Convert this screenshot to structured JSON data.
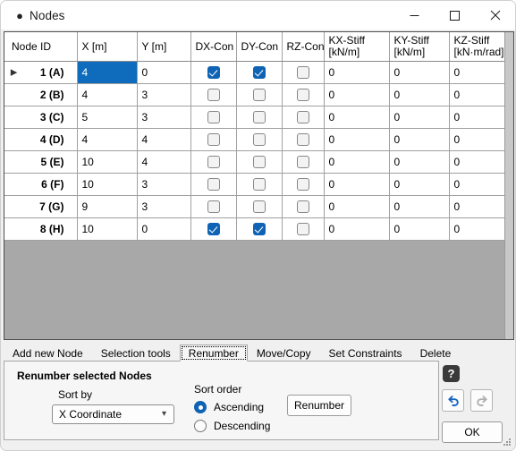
{
  "window": {
    "title": "Nodes",
    "icon": "app-dot-icon",
    "minimize": "—",
    "maximize": "☐",
    "close": "✕"
  },
  "table": {
    "columns": [
      {
        "line1": "Node ID",
        "line2": ""
      },
      {
        "line1": "X [m]",
        "line2": ""
      },
      {
        "line1": "Y [m]",
        "line2": ""
      },
      {
        "line1": "DX-Con",
        "line2": ""
      },
      {
        "line1": "DY-Con",
        "line2": ""
      },
      {
        "line1": "RZ-Con",
        "line2": ""
      },
      {
        "line1": "KX-Stiff",
        "line2": "[kN/m]"
      },
      {
        "line1": "KY-Stiff",
        "line2": "[kN/m]"
      },
      {
        "line1": "KZ-Stiff",
        "line2": "[kN·m/rad]"
      }
    ],
    "rows": [
      {
        "node": "1 (A)",
        "x": "4",
        "y": "0",
        "dx": true,
        "dy": true,
        "rz": false,
        "kx": "0",
        "ky": "0",
        "kz": "0",
        "marker": "▶",
        "selected_cell": "x"
      },
      {
        "node": "2 (B)",
        "x": "4",
        "y": "3",
        "dx": false,
        "dy": false,
        "rz": false,
        "kx": "0",
        "ky": "0",
        "kz": "0",
        "marker": "",
        "selected_cell": ""
      },
      {
        "node": "3 (C)",
        "x": "5",
        "y": "3",
        "dx": false,
        "dy": false,
        "rz": false,
        "kx": "0",
        "ky": "0",
        "kz": "0",
        "marker": "",
        "selected_cell": ""
      },
      {
        "node": "4 (D)",
        "x": "4",
        "y": "4",
        "dx": false,
        "dy": false,
        "rz": false,
        "kx": "0",
        "ky": "0",
        "kz": "0",
        "marker": "",
        "selected_cell": ""
      },
      {
        "node": "5 (E)",
        "x": "10",
        "y": "4",
        "dx": false,
        "dy": false,
        "rz": false,
        "kx": "0",
        "ky": "0",
        "kz": "0",
        "marker": "",
        "selected_cell": ""
      },
      {
        "node": "6 (F)",
        "x": "10",
        "y": "3",
        "dx": false,
        "dy": false,
        "rz": false,
        "kx": "0",
        "ky": "0",
        "kz": "0",
        "marker": "",
        "selected_cell": ""
      },
      {
        "node": "7 (G)",
        "x": "9",
        "y": "3",
        "dx": false,
        "dy": false,
        "rz": false,
        "kx": "0",
        "ky": "0",
        "kz": "0",
        "marker": "",
        "selected_cell": ""
      },
      {
        "node": "8 (H)",
        "x": "10",
        "y": "0",
        "dx": true,
        "dy": true,
        "rz": false,
        "kx": "0",
        "ky": "0",
        "kz": "0",
        "marker": "",
        "selected_cell": ""
      }
    ]
  },
  "tabs": [
    {
      "label": "Add new Node",
      "active": false
    },
    {
      "label": "Selection tools",
      "active": false
    },
    {
      "label": "Renumber",
      "active": true
    },
    {
      "label": "Move/Copy",
      "active": false
    },
    {
      "label": "Set Constraints",
      "active": false
    },
    {
      "label": "Delete",
      "active": false
    }
  ],
  "panel": {
    "title": "Renumber selected Nodes",
    "sort_by_label": "Sort by",
    "sort_by_value": "X Coordinate",
    "sort_order_label": "Sort order",
    "ascending_label": "Ascending",
    "descending_label": "Descending",
    "ascending_selected": true,
    "descending_selected": false,
    "renumber_button": "Renumber"
  },
  "actions": {
    "help": "?",
    "ok": "OK"
  },
  "colors": {
    "accent": "#0f63b5",
    "selection": "#0f6cbd",
    "grid_gray": "#a8a8a8",
    "panel_bg": "#f6f6f6"
  }
}
